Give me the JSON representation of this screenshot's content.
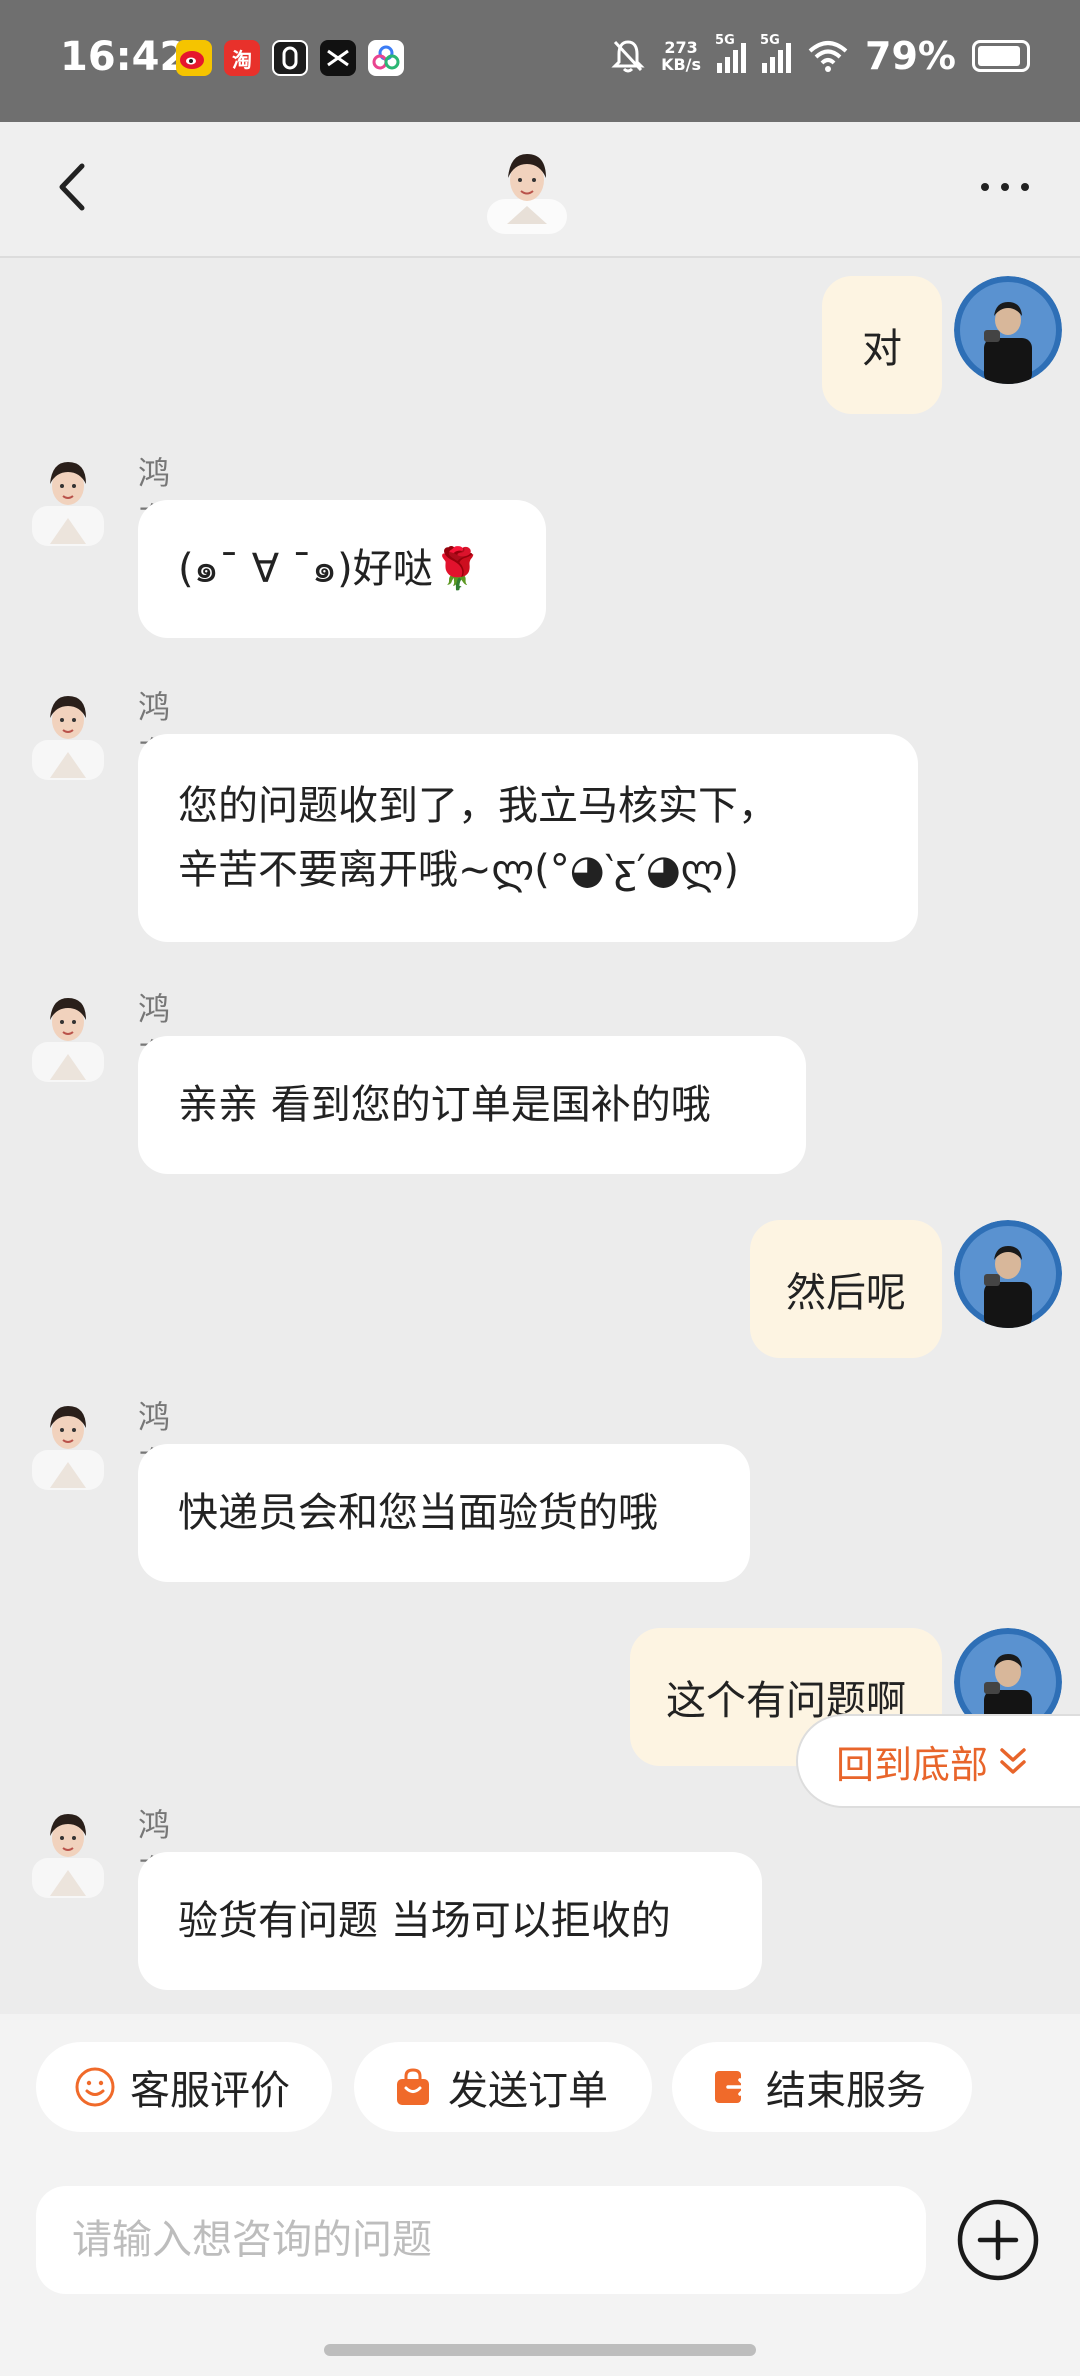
{
  "status_bar": {
    "time": "16:42",
    "net_speed_value": "273",
    "net_speed_unit": "KB/s",
    "sim1": "5G",
    "sim2": "5G",
    "battery": "79%",
    "app_icons": [
      "weibo-icon",
      "taobao-icon",
      "app-icon",
      "capcut-icon",
      "cloud-icon"
    ]
  },
  "header": {
    "back_icon": "chevron-left-icon",
    "avatar_icon": "agent-avatar-icon",
    "more_icon": "more-dots-icon"
  },
  "colors": {
    "accent": "#e8652b",
    "user_bubble": "#fdf4e2",
    "agent_bubble": "#ffffff",
    "background": "#ececec"
  },
  "messages": [
    {
      "from": "user",
      "text": "对"
    },
    {
      "from": "agent",
      "name": "鸿东时",
      "text": "(๑¯ ∀ ¯๑)好哒🌹"
    },
    {
      "from": "agent",
      "name": "鸿东时",
      "lines": [
        "您的问题收到了，我立马核实下，",
        "辛苦不要离开哦~ლ(°◕‵ƹ′◕ლ)"
      ]
    },
    {
      "from": "agent",
      "name": "鸿东时",
      "text": "亲亲 看到您的订单是国补的哦"
    },
    {
      "from": "user",
      "text": "然后呢"
    },
    {
      "from": "agent",
      "name": "鸿东时",
      "text": "快递员会和您当面验货的哦"
    },
    {
      "from": "user",
      "text": "这个有问题啊"
    },
    {
      "from": "agent",
      "name": "鸿东时",
      "text": "验货有问题 当场可以拒收的"
    }
  ],
  "back_to_bottom": "回到底部",
  "quick_actions": [
    {
      "label": "客服评价",
      "icon": "smiley-icon"
    },
    {
      "label": "发送订单",
      "icon": "shopping-bag-icon"
    },
    {
      "label": "结束服务",
      "icon": "exit-icon"
    }
  ],
  "input": {
    "placeholder": "请输入想咨询的问题",
    "value": "",
    "plus_icon": "plus-circle-icon"
  }
}
